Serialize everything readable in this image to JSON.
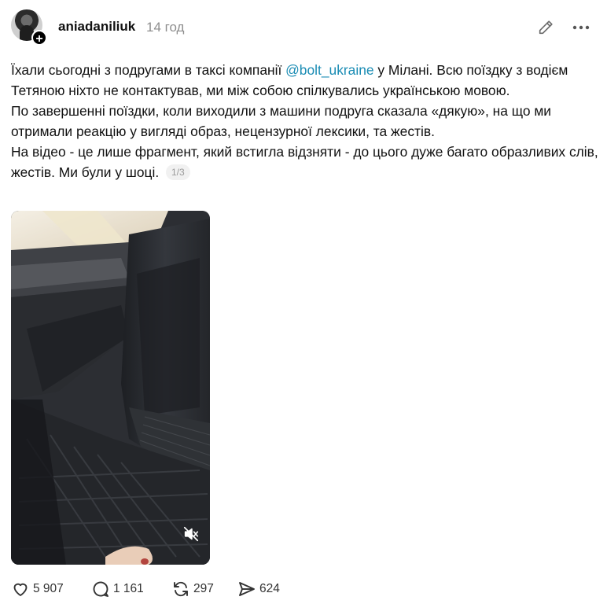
{
  "header": {
    "username": "aniadaniliuk",
    "timestamp": "14 год"
  },
  "post": {
    "line1_before": "Їхали сьогодні з подругами в таксі компанії ",
    "mention": "@bolt_ukraine",
    "line1_after": " у Мілані. Всю поїздку з водієм Тетяною ніхто не контактував, ми між собою спілкувались українською мовою.",
    "paragraph2": "По завершенні поїздки, коли виходили з машини подруга сказала «дякую», на що ми отримали реакцію у вигляді образ, нецензурної лексики, та жестів.",
    "paragraph3": "На відео - це лише фрагмент, який встигла відзняти - до цього дуже багато образливих слів, жестів. Ми були у шоці.",
    "media_pager": "1/3"
  },
  "video": {
    "muted": true
  },
  "actions": {
    "likes": "5 907",
    "comments": "1 161",
    "reposts": "297",
    "shares": "624"
  },
  "icons": {
    "edit": "pencil-icon",
    "more": "more-horizontal-icon",
    "mute": "speaker-muted-icon",
    "like": "heart-icon",
    "comment": "comment-bubble-icon",
    "repost": "repost-arrows-icon",
    "share": "paper-plane-icon"
  }
}
